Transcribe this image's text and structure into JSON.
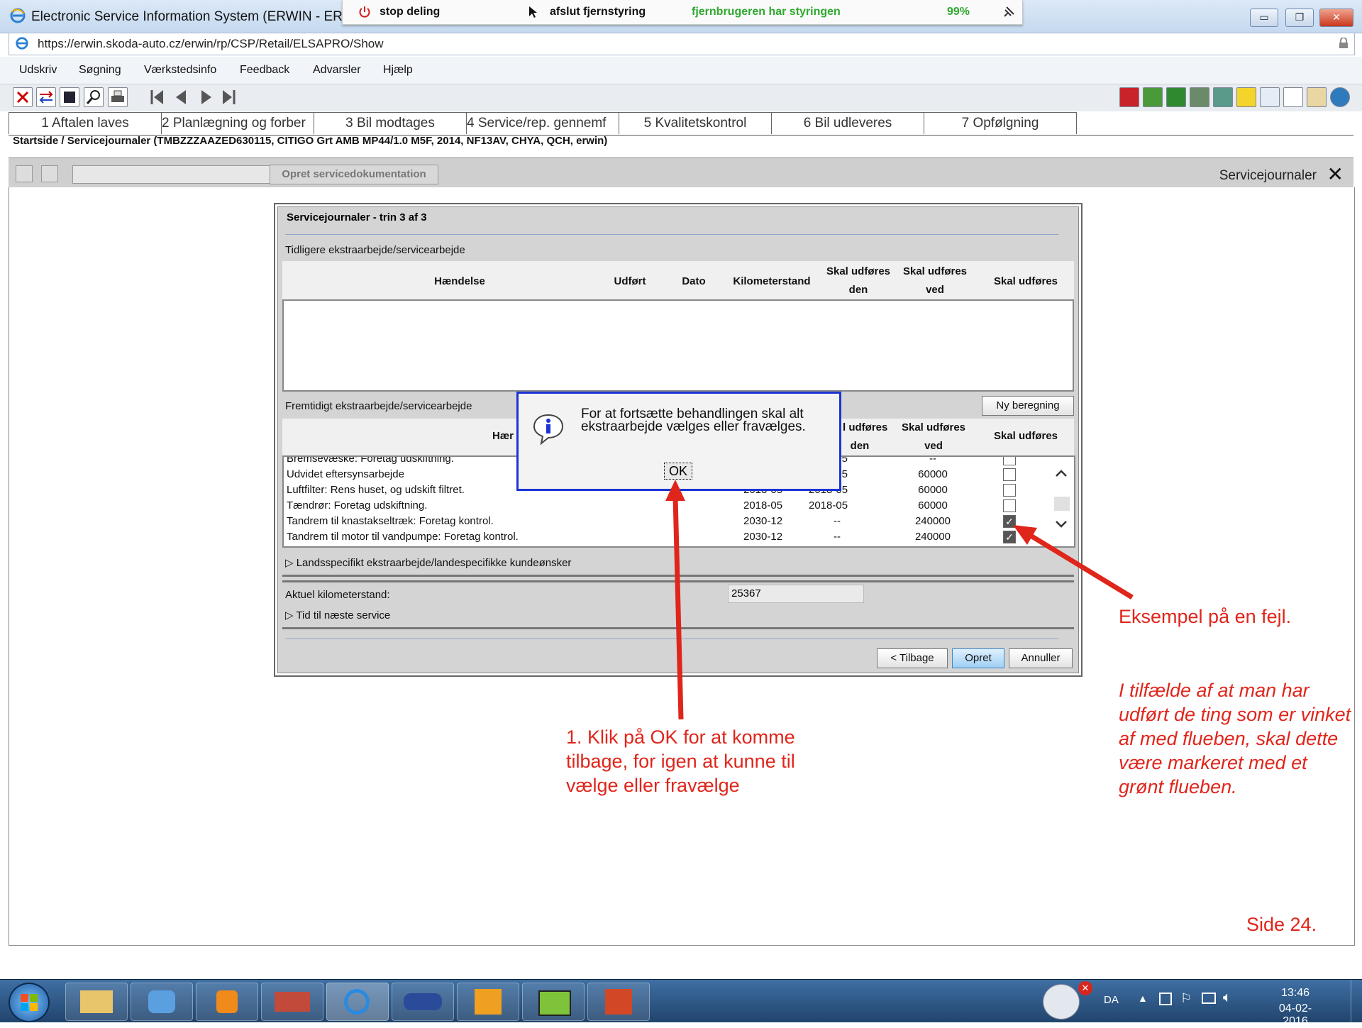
{
  "window": {
    "title": "Electronic Service Information System (ERWIN - ERWIN)",
    "minimize": "▭",
    "restore": "❐",
    "close": "✕"
  },
  "remote_bar": {
    "stop_sharing": "stop deling",
    "end_remote": "afslut fjernstyring",
    "remote_user_control": "fjernbrugeren har styringen",
    "percent": "99%"
  },
  "address": {
    "url": "https://erwin.skoda-auto.cz/erwin/rp/CSP/Retail/ELSAPRO/Show"
  },
  "menu": [
    "Udskriv",
    "Søgning",
    "Værkstedsinfo",
    "Feedback",
    "Advarsler",
    "Hjælp"
  ],
  "tabs": [
    "1 Aftalen laves",
    "2 Planlægning og forber",
    "3 Bil modtages",
    "4 Service/rep. gennemf",
    "5 Kvalitetskontrol",
    "6 Bil udleveres",
    "7 Opfølgning"
  ],
  "breadcrumb": "Startside / Servicejournaler (TMBZZZAAZED630115, CITIGO Grt AMB MP44/1.0 M5F, 2014, NF13AV, CHYA, QCH, erwin)",
  "strip": {
    "create_button": "Opret servicedokumentation",
    "title": "Servicejournaler",
    "close": "✕"
  },
  "panel": {
    "title": "Servicejournaler - trin 3 af 3",
    "previous_section": "Tidligere ekstraarbejde/servicearbejde",
    "future_section": "Fremtidigt ekstraarbejde/servicearbejde",
    "recalc_button": "Ny beregning",
    "columns": {
      "event": "Hændelse",
      "done": "Udført",
      "date": "Dato",
      "mileage": "Kilometerstand",
      "due_at_1": "Skal udføres",
      "due_at_2": "den",
      "due_by_1": "Skal udføres",
      "due_by_2": "ved",
      "to_do": "Skal udføres"
    },
    "future_header_event_partial": "Hær",
    "future_header_due_at_partial": "l udføres",
    "rows": [
      {
        "event": "Bremsevæske: Foretag udskiftning.",
        "date": "",
        "due_at": "7-05",
        "due_by": "--",
        "checked": false
      },
      {
        "event": "Udvidet eftersynsarbejde",
        "date": "",
        "due_at": "7-05",
        "due_by": "60000",
        "checked": false
      },
      {
        "event": "Luftfilter: Rens huset, og udskift filtret.",
        "date": "2018-05",
        "due_at": "2018-05",
        "due_by": "60000",
        "checked": false
      },
      {
        "event": "Tændrør: Foretag udskiftning.",
        "date": "2018-05",
        "due_at": "2018-05",
        "due_by": "60000",
        "checked": false
      },
      {
        "event": "Tandrem til knastakseltræk: Foretag kontrol.",
        "date": "2030-12",
        "due_at": "--",
        "due_by": "240000",
        "checked": true
      },
      {
        "event": "Tandrem til motor til vandpumpe: Foretag kontrol.",
        "date": "2030-12",
        "due_at": "--",
        "due_by": "240000",
        "checked": true
      }
    ],
    "country_specific": "Landsspecifikt ekstraarbejde/landespecifikke kundeønsker",
    "mileage_label": "Aktuel kilometerstand:",
    "mileage_value": "25367",
    "next_service": "Tid til næste service",
    "back_button": "< Tilbage",
    "create_button": "Opret",
    "cancel_button": "Annuller"
  },
  "dialog": {
    "message": "For at fortsætte behandlingen skal alt ekstraarbejde vælges eller fravælges.",
    "ok": "OK"
  },
  "annotations": {
    "click_ok": "1. Klik på OK for at komme tilbage, for igen at kunne til vælge eller fravælge",
    "error_example": "Eksempel på en fejl.",
    "note": "I tilfælde af at man har udført de ting som er vinket af med flueben, skal dette være markeret med et grønt flueben.",
    "page": "Side 24."
  },
  "taskbar": {
    "language": "DA",
    "time": "13:46",
    "date": "04-02-2016"
  },
  "colors": {
    "annotation_red": "#e0251b",
    "dialog_border": "#1c34d6",
    "remote_green": "#2ea82e",
    "remote_red": "#d21c1c"
  }
}
